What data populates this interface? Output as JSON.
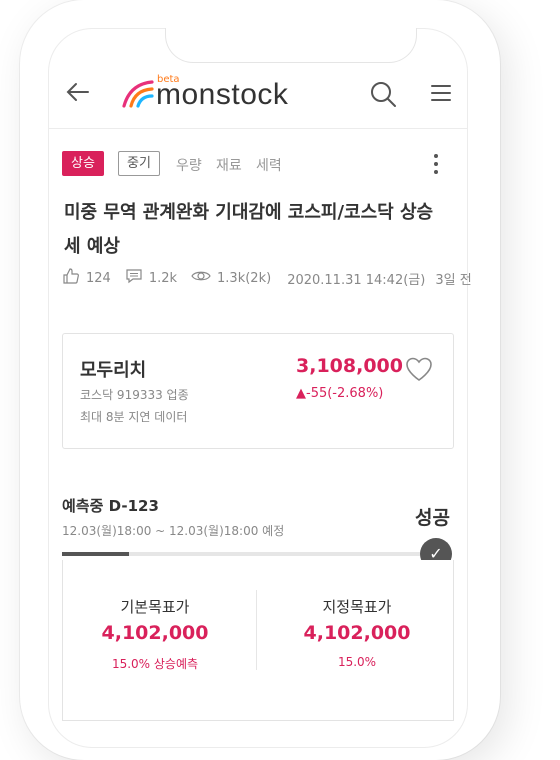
{
  "header": {
    "logo_beta": "beta",
    "logo_text": "monstock"
  },
  "post": {
    "tag_primary": "상승",
    "tag_secondary": "중기",
    "tags_plain": [
      "우량",
      "재료",
      "세력"
    ],
    "headline": "미중 무역 관계완화 기대감에 코스피/코스닥 상승세 예상",
    "likes": "124",
    "comments": "1.2k",
    "views": "1.3k(2k)",
    "datetime": "2020.11.31 14:42(금)",
    "relative_time": "3일 전"
  },
  "stock": {
    "name": "모두리치",
    "market_info": "코스닥 919333 업종",
    "delay_note": "최대 8분 지연 데이터",
    "price": "3,108,000",
    "change": "▲-55(-2.68%)"
  },
  "prediction": {
    "title": "예측중 D-123",
    "range": "12.03(월)18:00 ~ 12.03(월)18:00  예정",
    "status": "성공",
    "progress_fraction": 0.18
  },
  "targets": {
    "basic_label": "기본목표가",
    "basic_value": "4,102,000",
    "basic_sub": "15.0% 상승예측",
    "custom_label": "지정목표가",
    "custom_value": "4,102,000",
    "custom_sub": "15.0%"
  },
  "colors": {
    "accent": "#d9215b",
    "logo_orange": "#ff7a1a",
    "logo_blue": "#1fb6ff",
    "logo_pink": "#e8307a"
  }
}
